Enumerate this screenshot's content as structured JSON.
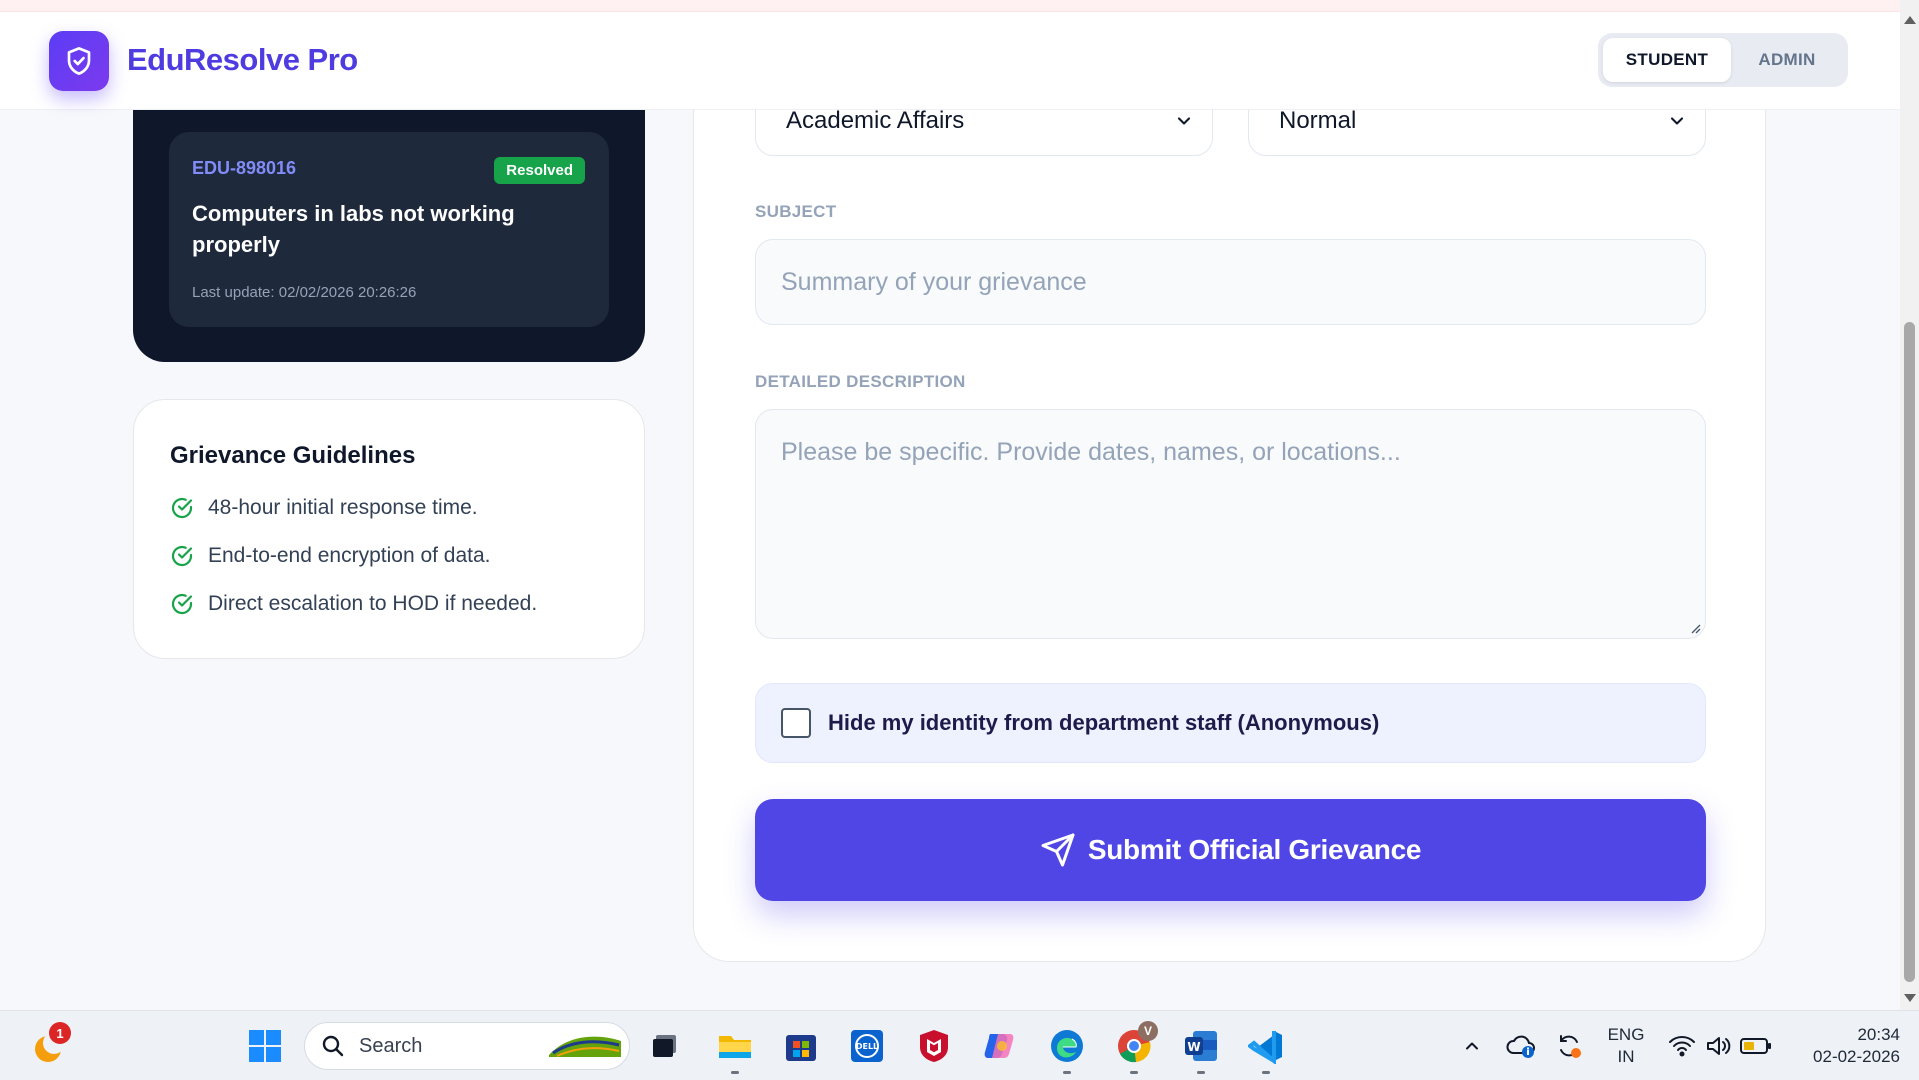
{
  "app": {
    "name": "EduResolve Pro"
  },
  "header": {
    "roles": {
      "student": "STUDENT",
      "admin": "ADMIN"
    }
  },
  "recent_ticket": {
    "id": "EDU-898016",
    "status": "Resolved",
    "title": "Computers in labs not working properly",
    "last_update": "Last update: 02/02/2026 20:26:26"
  },
  "guidelines": {
    "title": "Grievance Guidelines",
    "items": [
      "48-hour initial response time.",
      "End-to-end encryption of data.",
      "Direct escalation to HOD if needed."
    ]
  },
  "form": {
    "department_value": "Academic Affairs",
    "priority_value": "Normal",
    "subject_label": "SUBJECT",
    "subject_placeholder": "Summary of your grievance",
    "description_label": "DETAILED DESCRIPTION",
    "description_placeholder": "Please be specific. Provide dates, names, or locations...",
    "anonymous_label": "Hide my identity from department staff (Anonymous)",
    "submit_label": "Submit Official Grievance"
  },
  "taskbar": {
    "search_label": "Search",
    "notification_count": "1",
    "language": "ENG",
    "region": "IN",
    "time": "20:34",
    "date": "02-02-2026",
    "chrome_profile_initial": "V"
  },
  "colors": {
    "brand": "#4f46e5",
    "dark_card": "#0f172a",
    "resolved_badge": "#16a34a",
    "check_green": "#16a34a"
  }
}
